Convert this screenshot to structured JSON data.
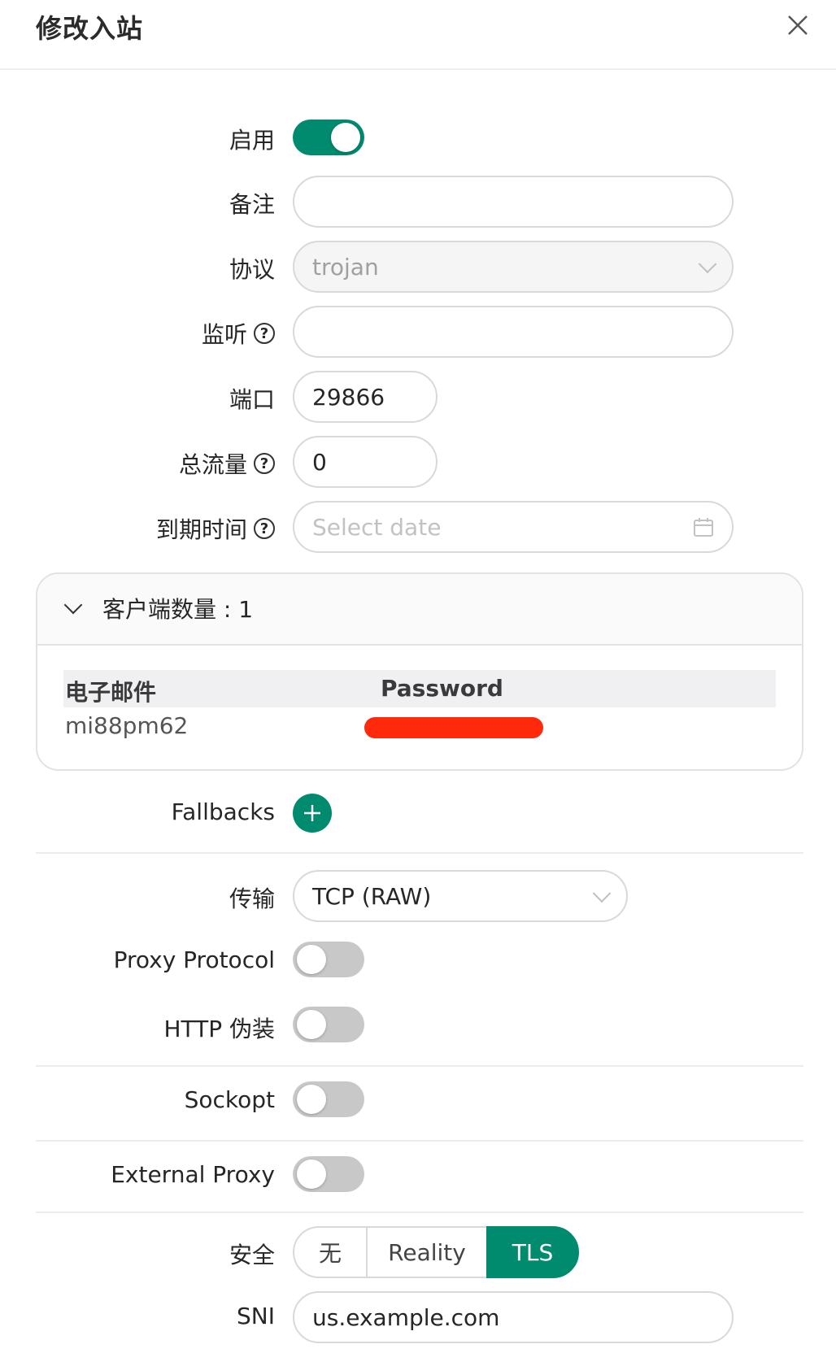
{
  "modal": {
    "title": "修改入站"
  },
  "form": {
    "enable_label": "启用",
    "enable_on": true,
    "remark_label": "备注",
    "remark_value": "",
    "protocol_label": "协议",
    "protocol_value": "trojan",
    "listen_label": "监听",
    "listen_value": "",
    "port_label": "端口",
    "port_value": "29866",
    "traffic_label": "总流量",
    "traffic_value": "0",
    "expiry_label": "到期时间",
    "expiry_placeholder": "Select date"
  },
  "clients": {
    "header": "客户端数量 : 1",
    "columns": [
      "电子邮件",
      "Password"
    ],
    "rows": [
      {
        "email": "mi88pm62"
      }
    ]
  },
  "fallbacks": {
    "label": "Fallbacks"
  },
  "transport": {
    "label": "传输",
    "value": "TCP (RAW)"
  },
  "proxy_protocol": {
    "label": "Proxy Protocol",
    "on": false
  },
  "http_camouflage": {
    "label": "HTTP 伪装",
    "on": false
  },
  "sockopt": {
    "label": "Sockopt",
    "on": false
  },
  "external_proxy": {
    "label": "External Proxy",
    "on": false
  },
  "security": {
    "label": "安全",
    "options": [
      "无",
      "Reality",
      "TLS"
    ],
    "selected": "TLS"
  },
  "sni": {
    "label": "SNI",
    "value": "us.example.com"
  },
  "colors": {
    "accent": "#008a6e",
    "redaction": "#ff2a0c"
  }
}
